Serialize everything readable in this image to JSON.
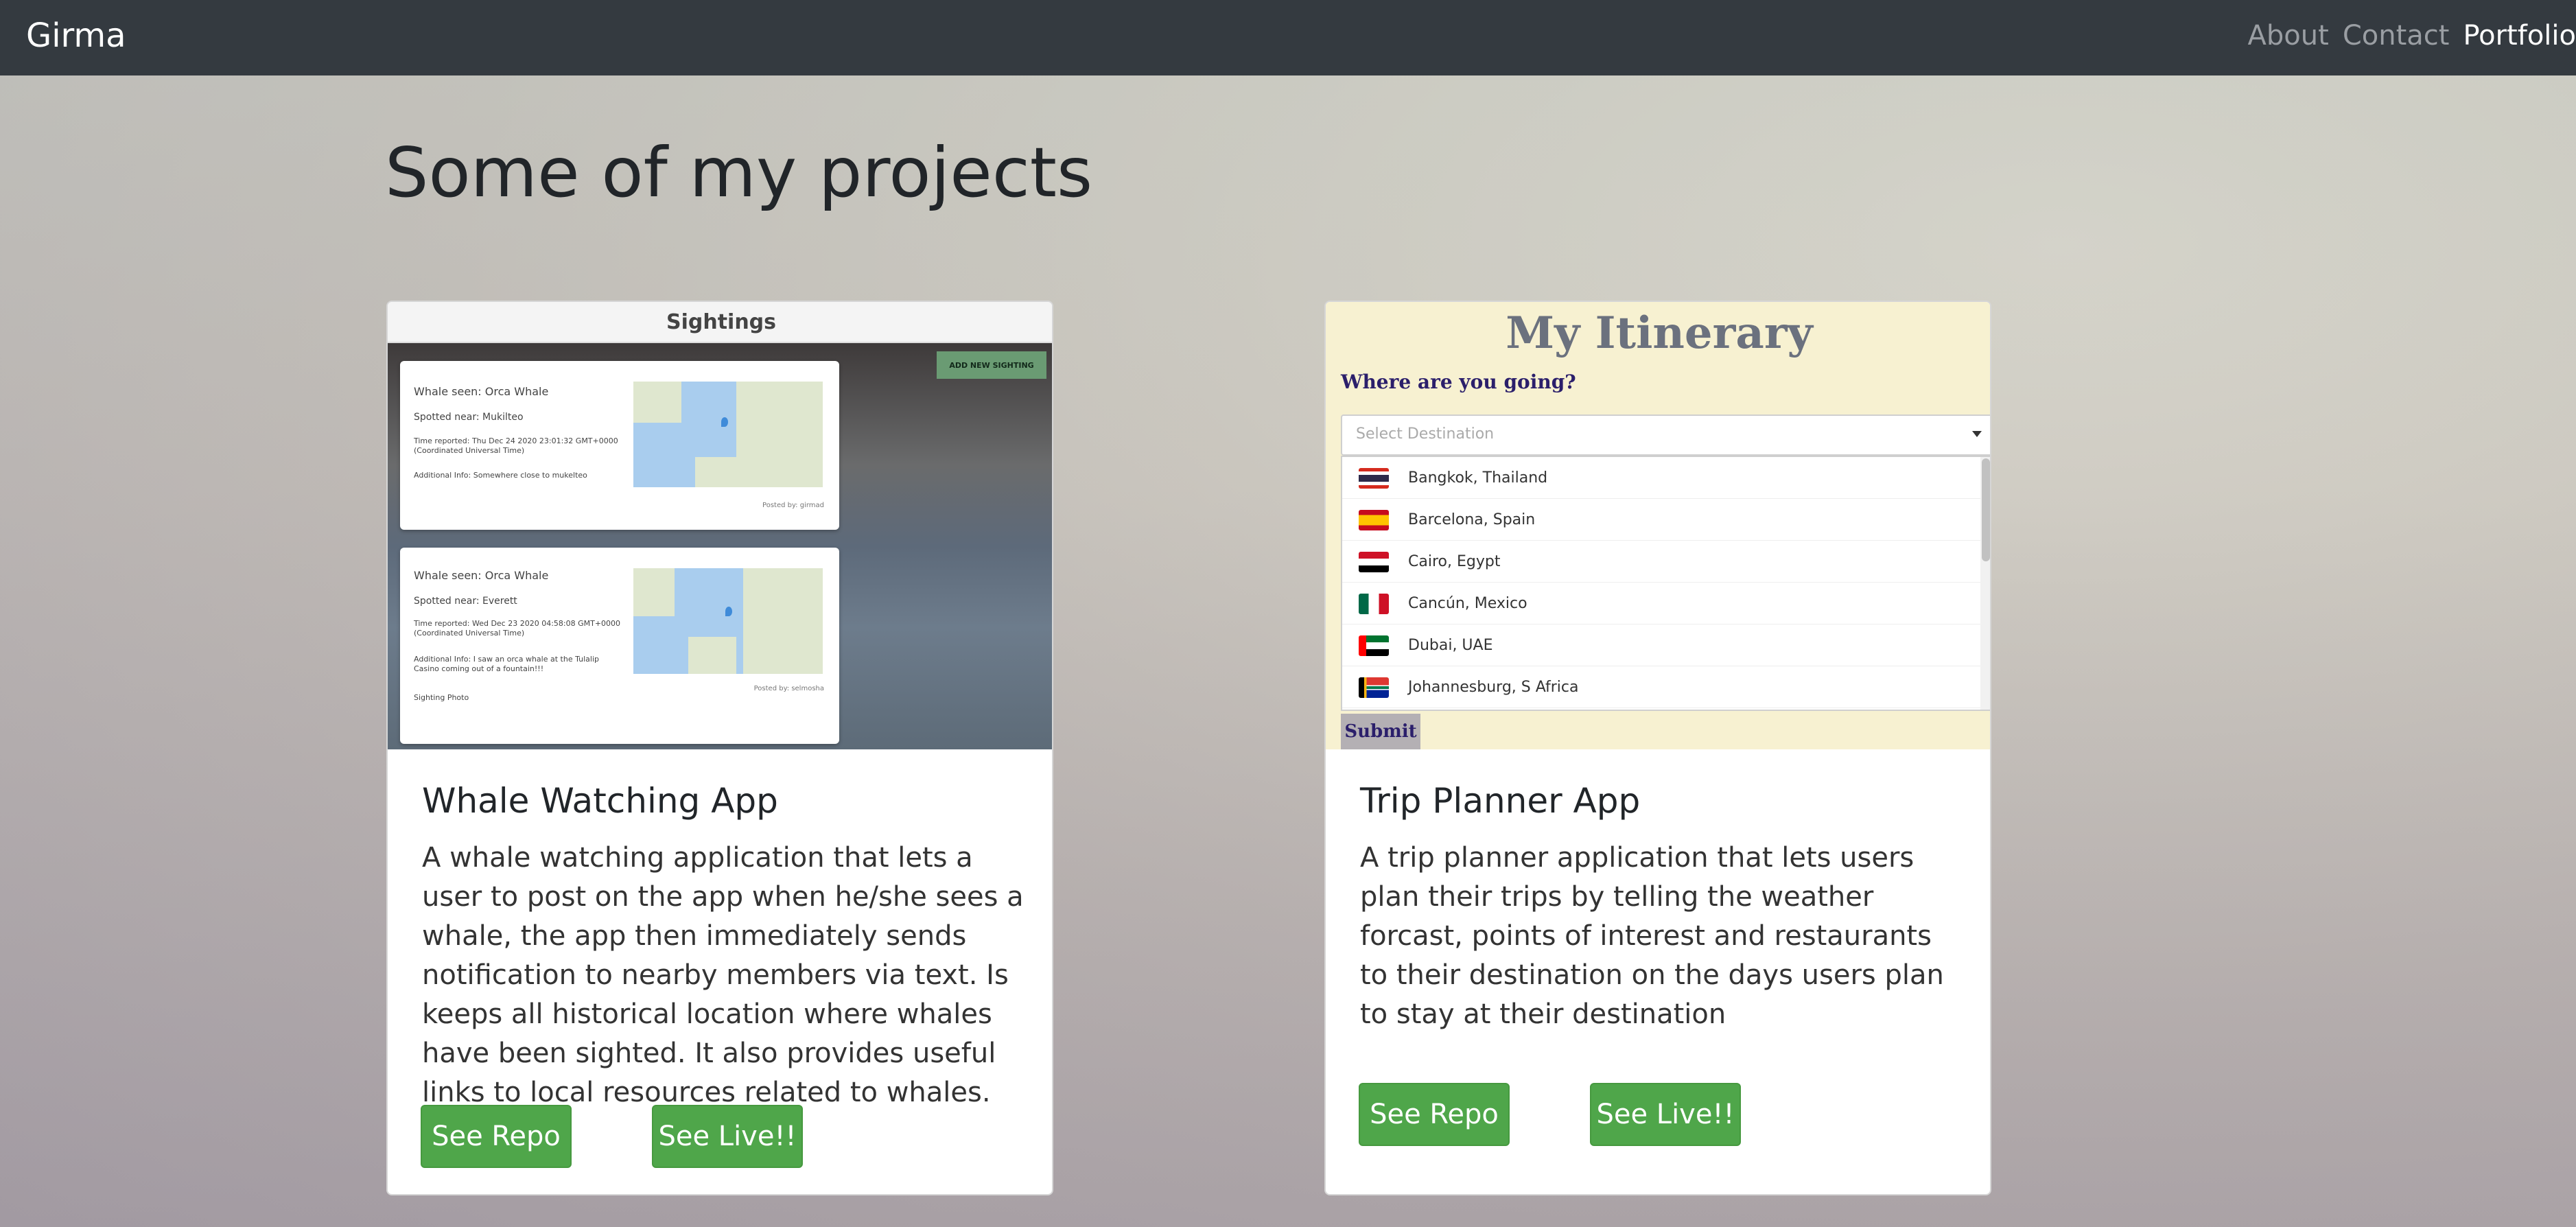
{
  "navbar": {
    "brand": "Girma",
    "links": [
      {
        "label": "About"
      },
      {
        "label": "Contact"
      },
      {
        "label": "Portfolio"
      }
    ]
  },
  "page_title": "Some of my projects",
  "projects": [
    {
      "title": "Whale Watching App",
      "description": "A whale watching application that lets a user to post on the app when he/she sees a whale, the app then immediately sends notification to nearby members via text. Is keeps all historical location where whales have been sighted. It also provides useful links to local resources related to whales.",
      "repo_label": "See Repo",
      "live_label": "See Live!!",
      "screenshot": {
        "header": "Sightings",
        "add_button": "ADD NEW SIGHTING",
        "sightings": [
          {
            "whale": "Whale seen: Orca Whale",
            "near": "Spotted near: Mukilteo",
            "time": "Time reported: Thu Dec 24 2020 23:01:32 GMT+0000 (Coordinated Universal Time)",
            "info": "Additional Info: Somewhere close to mukelteo",
            "posted": "Posted by: girmad"
          },
          {
            "whale": "Whale seen: Orca Whale",
            "near": "Spotted near: Everett",
            "time": "Time reported: Wed Dec 23 2020 04:58:08 GMT+0000 (Coordinated Universal Time)",
            "info": "Additional Info: I saw an orca whale at the Tulalip Casino coming out of a fountain!!!",
            "photo": "Sighting Photo",
            "posted": "Posted by: selmosha"
          }
        ]
      }
    },
    {
      "title": "Trip Planner App",
      "description": "A trip planner application that lets users plan their trips by telling the weather forcast, points of interest and restaurants to their destination on the days users plan to stay at their destination",
      "repo_label": "See Repo",
      "live_label": "See Live!!",
      "screenshot": {
        "title": "My Itinerary",
        "question": "Where are you going?",
        "select_placeholder": "Select Destination",
        "destinations": [
          {
            "label": "Bangkok, Thailand",
            "flag": "thailand-flag-icon"
          },
          {
            "label": "Barcelona, Spain",
            "flag": "spain-flag-icon"
          },
          {
            "label": "Cairo, Egypt",
            "flag": "egypt-flag-icon"
          },
          {
            "label": "Cancún, Mexico",
            "flag": "mexico-flag-icon"
          },
          {
            "label": "Dubai, UAE",
            "flag": "uae-flag-icon"
          },
          {
            "label": "Johannesburg, S Africa",
            "flag": "south-africa-flag-icon"
          }
        ],
        "submit_label": "Submit"
      }
    }
  ],
  "colors": {
    "navbar": "#343a40",
    "button": "#4fa64a",
    "itinerary_bg": "#f7f1d1"
  }
}
